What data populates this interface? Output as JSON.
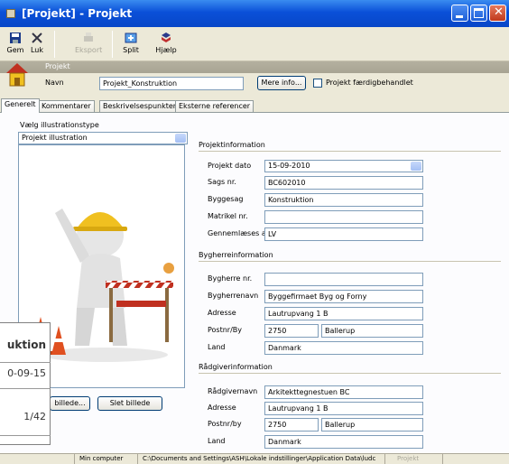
{
  "window": {
    "title": "[Projekt] - Projekt"
  },
  "toolbar": {
    "save": "Gem",
    "close": "Luk",
    "export": "Eksport",
    "split": "Split",
    "help": "Hjælp"
  },
  "header": {
    "strip_label": "Projekt"
  },
  "project": {
    "name_label": "Navn",
    "name_value": "Projekt_Konstruktion",
    "more_info_button": "Mere info...",
    "done_label": "Projekt færdigbehandlet"
  },
  "tabs": [
    "Generelt",
    "Kommentarer",
    "Beskrivelsespunkter",
    "Eksterne referencer"
  ],
  "illustration": {
    "type_label": "Vælg illustrationstype",
    "type_value": "Projekt illustration",
    "choose_button": "billede...",
    "delete_button": "Slet billede"
  },
  "projektinfo": {
    "heading": "Projektinformation",
    "date_label": "Projekt dato",
    "date_value": "15-09-2010",
    "sags_label": "Sags nr.",
    "sags_value": "BC602010",
    "byggesag_label": "Byggesag",
    "byggesag_value": "Konstruktion",
    "matrikel_label": "Matrikel nr.",
    "matrikel_value": "",
    "gennem_label": "Gennemlæses af",
    "gennem_value": "LV"
  },
  "bygherre": {
    "heading": "Bygherreinformation",
    "nr_label": "Bygherre nr.",
    "nr_value": "",
    "navn_label": "Bygherrenavn",
    "navn_value": "Byggefirmaet Byg og Forny",
    "adresse_label": "Adresse",
    "adresse_value": "Lautrupvang 1 B",
    "postnr_label": "Postnr/By",
    "postnr_value": "2750",
    "by_value": "Ballerup",
    "land_label": "Land",
    "land_value": "Danmark"
  },
  "raadgiver": {
    "heading": "Rådgiverinformation",
    "navn_label": "Rådgivernavn",
    "navn_value": "Arkitekttegnestuen BC",
    "adresse_label": "Adresse",
    "adresse_value": "Lautrupvang 1 B",
    "postnr_label": "Postnr/by",
    "postnr_value": "2750",
    "by_value": "Ballerup",
    "land_label": "Land",
    "land_value": "Danmark"
  },
  "overlay_card": {
    "title_fragment": "uktion",
    "date_fragment": "0-09-15",
    "page": "1/42"
  },
  "statusbar": {
    "computer": "Min computer",
    "path": "C:\\Documents and Settings\\ASH\\Lokale indstillinger\\Application Data\\ludc",
    "module": "Projekt"
  },
  "colors": {
    "titlebar": "#0a50d8",
    "accent_orange": "#e8a040"
  }
}
